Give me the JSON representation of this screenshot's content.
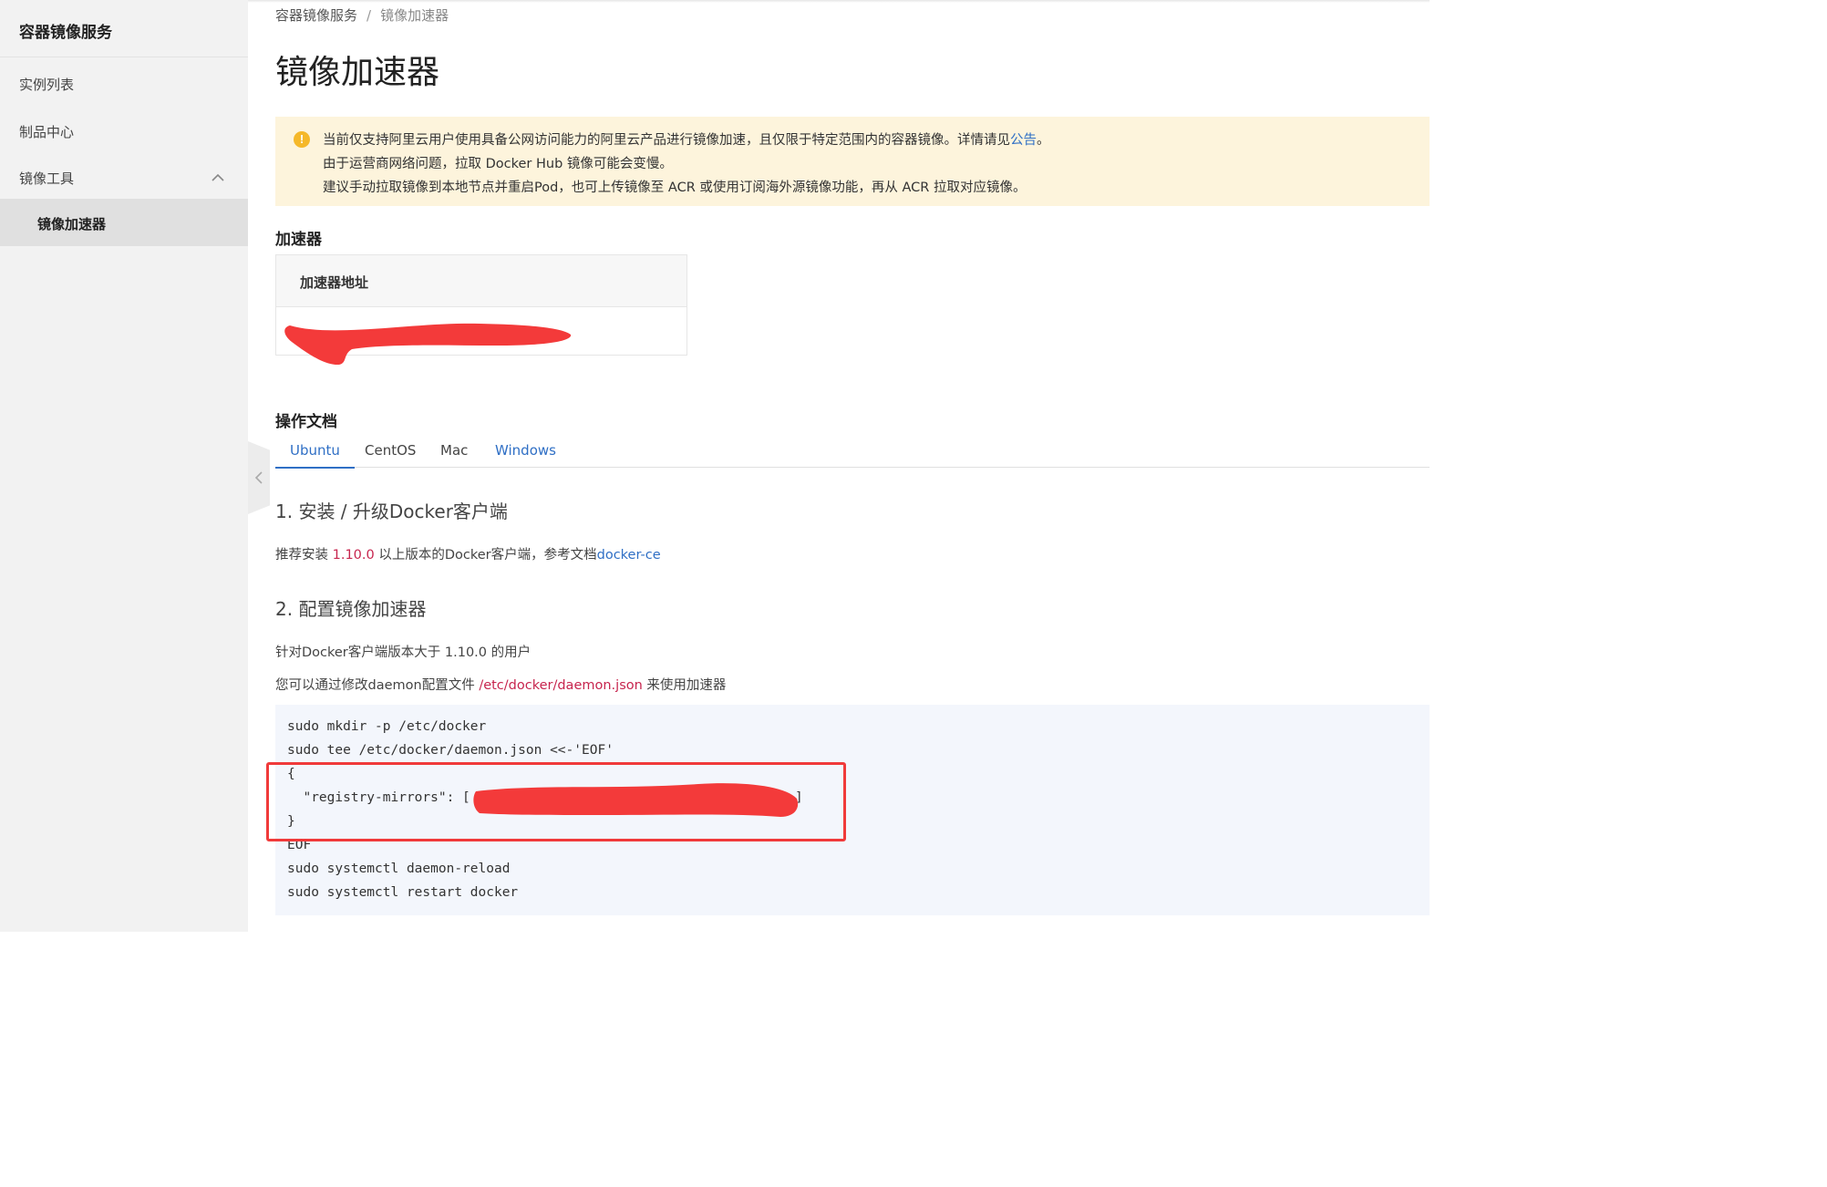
{
  "sidebar": {
    "title": "容器镜像服务",
    "items": [
      {
        "label": "实例列表"
      },
      {
        "label": "制品中心"
      },
      {
        "label": "镜像工具"
      },
      {
        "label": "镜像加速器"
      }
    ]
  },
  "breadcrumb": {
    "root": "容器镜像服务",
    "separator": "/",
    "current": "镜像加速器"
  },
  "page_title": "镜像加速器",
  "alert": {
    "line1_prefix": "当前仅支持阿里云用户使用具备公网访问能力的阿里云产品进行镜像加速，且仅限于特定范围内的容器镜像。详情请见",
    "line1_link": "公告",
    "line1_suffix": "。",
    "line2": "由于运营商网络问题，拉取 Docker Hub 镜像可能会变慢。",
    "line3": "建议手动拉取镜像到本地节点并重启Pod，也可上传镜像至 ACR 或使用订阅海外源镜像功能，再从 ACR 拉取对应镜像。",
    "icon": "!"
  },
  "accelerator": {
    "heading": "加速器",
    "column": "加速器地址"
  },
  "docs": {
    "heading": "操作文档",
    "tabs": [
      "Ubuntu",
      "CentOS",
      "Mac",
      "Windows"
    ],
    "step1": {
      "title": "1. 安装 / 升级Docker客户端",
      "text_prefix": "推荐安装 ",
      "version": "1.10.0",
      "text_mid": " 以上版本的Docker客户端，参考文档",
      "link": "docker-ce"
    },
    "step2": {
      "title": "2. 配置镜像加速器",
      "line1": "针对Docker客户端版本大于 1.10.0 的用户",
      "line2_prefix": "您可以通过修改daemon配置文件 ",
      "path": "/etc/docker/daemon.json",
      "line2_suffix": " 来使用加速器"
    },
    "code": [
      "sudo mkdir -p /etc/docker",
      "sudo tee /etc/docker/daemon.json <<-'EOF'",
      "{",
      "  \"registry-mirrors\": [",
      "}",
      "EOF",
      "sudo systemctl daemon-reload",
      "sudo systemctl restart docker"
    ],
    "code_tail": "]"
  },
  "colors": {
    "accent": "#2f6fc5",
    "alert_bg": "#fdf4dc",
    "redaction": "#f33a3a",
    "code_bg": "#f3f6fc"
  }
}
